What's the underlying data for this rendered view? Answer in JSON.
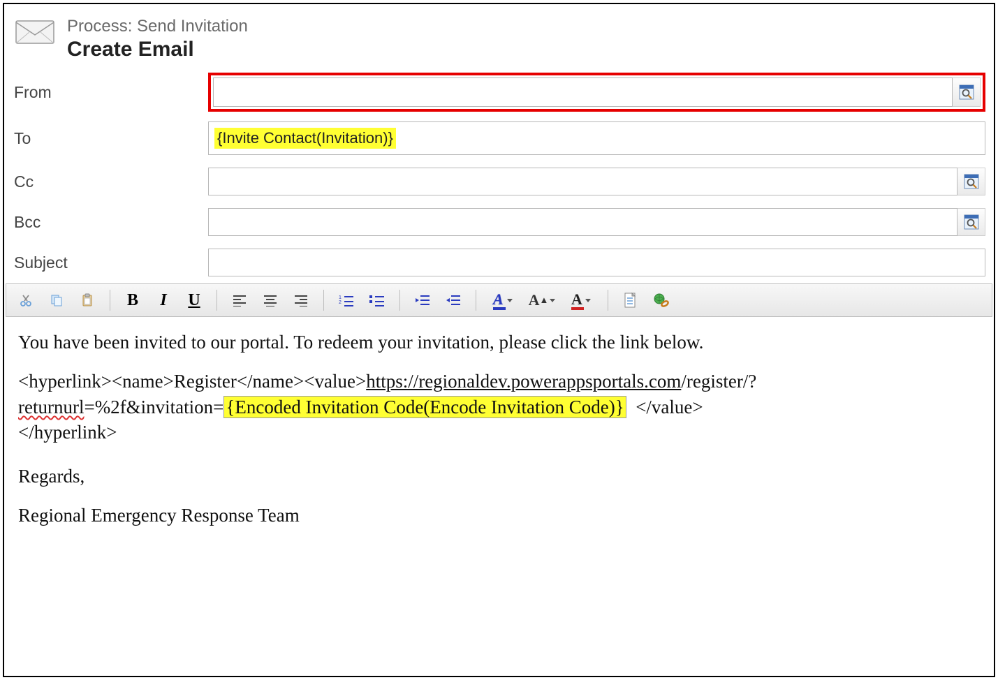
{
  "header": {
    "process_label": "Process: Send Invitation",
    "title": "Create Email"
  },
  "fields": {
    "from_label": "From",
    "to_label": "To",
    "cc_label": "Cc",
    "bcc_label": "Bcc",
    "subject_label": "Subject",
    "from_value": "",
    "to_chip": "{Invite Contact(Invitation)}",
    "cc_value": "",
    "bcc_value": "",
    "subject_value": ""
  },
  "toolbar": {
    "cut": "Cut",
    "copy": "Copy",
    "paste": "Paste",
    "bold": "B",
    "italic": "I",
    "underline": "U",
    "align_left": "Align Left",
    "align_center": "Align Center",
    "align_right": "Align Right",
    "ol": "Numbered List",
    "ul": "Bulleted List",
    "outdent": "Decrease Indent",
    "indent": "Increase Indent",
    "highlight": "Highlight Color",
    "font_size": "Font Size",
    "font_color": "Font Color",
    "insert_template": "Insert Template",
    "insert_link": "Insert Hyperlink"
  },
  "body": {
    "line1": "You have been invited to our portal. To redeem your invitation, please click the link below.",
    "hl_open": "<hyperlink><name>Register</name><value>",
    "url_part1": "https://regionaldev.powerappsportals.com",
    "url_part2": "/register/?",
    "url_part3_spell": "returnurl",
    "url_part4": "=%2f&invitation=",
    "code_chip": "{Encoded Invitation Code(Encode Invitation Code)}",
    "hl_close1": "</value>",
    "hl_close2": "</hyperlink>",
    "regards": "Regards,",
    "signature": "Regional Emergency Response Team"
  }
}
